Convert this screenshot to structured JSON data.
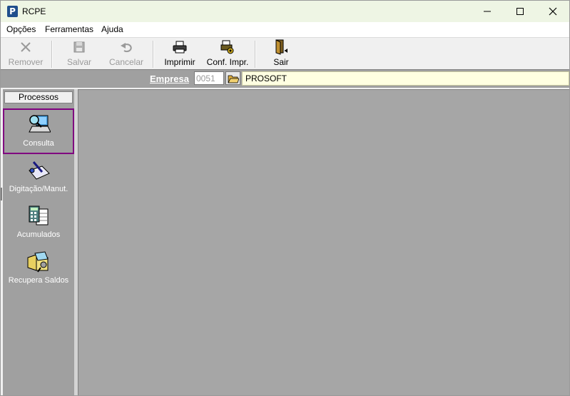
{
  "window": {
    "title": "RCPE",
    "app_icon_letter": "P",
    "controls": [
      "minimize-icon",
      "maximize-icon",
      "close-icon"
    ]
  },
  "menu": {
    "items": [
      {
        "label": "Opções"
      },
      {
        "label": "Ferramentas"
      },
      {
        "label": "Ajuda"
      }
    ]
  },
  "toolbar": {
    "remover": {
      "label": "Remover",
      "icon": "x-icon",
      "enabled": false
    },
    "salvar": {
      "label": "Salvar",
      "icon": "floppy-icon",
      "enabled": false
    },
    "cancelar": {
      "label": "Cancelar",
      "icon": "undo-icon",
      "enabled": false
    },
    "imprimir": {
      "label": "Imprimir",
      "icon": "printer-icon",
      "enabled": true
    },
    "conf_impr": {
      "label": "Conf. Impr.",
      "icon": "printer-setup-icon",
      "enabled": true
    },
    "sair": {
      "label": "Sair",
      "icon": "exit-door-icon",
      "enabled": true
    }
  },
  "empresa": {
    "label": "Empresa",
    "code": "0051",
    "name": "PROSOFT"
  },
  "sidebar": {
    "header": "Processos",
    "items": [
      {
        "label": "Consulta",
        "icon": "consulta-icon",
        "selected": true
      },
      {
        "label": "Digitação/Manut.",
        "icon": "edit-document-icon",
        "selected": false
      },
      {
        "label": "Acumulados",
        "icon": "calculator-icon",
        "selected": false
      },
      {
        "label": "Recupera Saldos",
        "icon": "recover-folder-icon",
        "selected": false
      }
    ]
  },
  "colors": {
    "titlebar": "#eef5e4",
    "empresa_bar": "#a0a0a0",
    "selection_outline": "#800080",
    "workspace": "#a6a6a6"
  }
}
